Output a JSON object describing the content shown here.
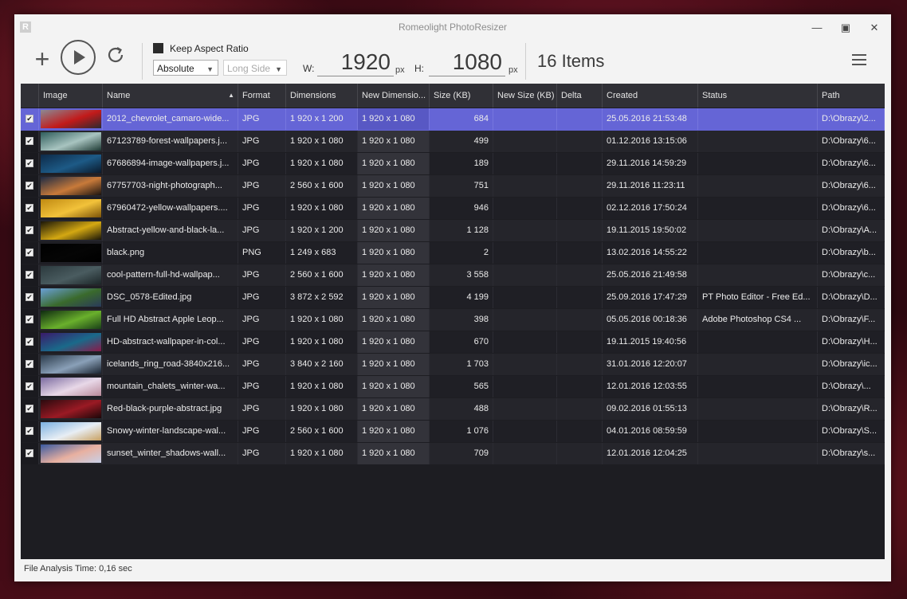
{
  "window": {
    "title": "Romeolight PhotoResizer",
    "logo_letter": "R"
  },
  "toolbar": {
    "keep_aspect_label": "Keep Aspect Ratio",
    "mode_value": "Absolute",
    "side_value": "Long Side",
    "width_label": "W:",
    "width_value": "1920",
    "height_label": "H:",
    "height_value": "1080",
    "unit": "px",
    "items_count": "16 Items"
  },
  "columns": [
    "Image",
    "Name",
    "Format",
    "Dimensions",
    "New Dimensio...",
    "Size (KB)",
    "New Size (KB)",
    "Delta",
    "Created",
    "Status",
    "Path"
  ],
  "rows": [
    {
      "name": "2012_chevrolet_camaro-wide...",
      "format": "JPG",
      "dims": "1 920 x 1 200",
      "newdims": "1 920 x 1 080",
      "size": "684",
      "created": "25.05.2016 21:53:48",
      "status": "",
      "path": "D:\\Obrazy\\2...",
      "thumb": [
        "#8a8a94",
        "#c21a1a",
        "#2a2a30"
      ],
      "selected": true
    },
    {
      "name": "67123789-forest-wallpapers.j...",
      "format": "JPG",
      "dims": "1 920 x 1 080",
      "newdims": "1 920 x 1 080",
      "size": "499",
      "created": "01.12.2016 13:15:06",
      "status": "",
      "path": "D:\\Obrazy\\6...",
      "thumb": [
        "#2f5d5c",
        "#a8c4c0",
        "#1e3a34"
      ]
    },
    {
      "name": "67686894-image-wallpapers.j...",
      "format": "JPG",
      "dims": "1 920 x 1 080",
      "newdims": "1 920 x 1 080",
      "size": "189",
      "created": "29.11.2016 14:59:29",
      "status": "",
      "path": "D:\\Obrazy\\6...",
      "thumb": [
        "#0d2a48",
        "#1d5a86",
        "#0a1a2c"
      ]
    },
    {
      "name": "67757703-night-photograph...",
      "format": "JPG",
      "dims": "2 560 x 1 600",
      "newdims": "1 920 x 1 080",
      "size": "751",
      "created": "29.11.2016 11:23:11",
      "status": "",
      "path": "D:\\Obrazy\\6...",
      "thumb": [
        "#1b2a44",
        "#c87a3a",
        "#1a1410"
      ]
    },
    {
      "name": "67960472-yellow-wallpapers....",
      "format": "JPG",
      "dims": "1 920 x 1 080",
      "newdims": "1 920 x 1 080",
      "size": "946",
      "created": "02.12.2016 17:50:24",
      "status": "",
      "path": "D:\\Obrazy\\6...",
      "thumb": [
        "#c08a12",
        "#f2c23a",
        "#7a5208"
      ]
    },
    {
      "name": "Abstract-yellow-and-black-la...",
      "format": "JPG",
      "dims": "1 920 x 1 200",
      "newdims": "1 920 x 1 080",
      "size": "1 128",
      "created": "19.11.2015 19:50:02",
      "status": "",
      "path": "D:\\Obrazy\\A...",
      "thumb": [
        "#1a1608",
        "#d4a812",
        "#1a1608"
      ]
    },
    {
      "name": "black.png",
      "format": "PNG",
      "dims": "1 249 x 683",
      "newdims": "1 920 x 1 080",
      "size": "2",
      "created": "13.02.2016 14:55:22",
      "status": "",
      "path": "D:\\Obrazy\\b...",
      "thumb": [
        "#000000",
        "#050505",
        "#000000"
      ]
    },
    {
      "name": "cool-pattern-full-hd-wallpap...",
      "format": "JPG",
      "dims": "2 560 x 1 600",
      "newdims": "1 920 x 1 080",
      "size": "3 558",
      "created": "25.05.2016 21:49:58",
      "status": "",
      "path": "D:\\Obrazy\\c...",
      "thumb": [
        "#2c3a3e",
        "#4a5c60",
        "#1c2628"
      ]
    },
    {
      "name": "DSC_0578-Edited.jpg",
      "format": "JPG",
      "dims": "3 872 x 2 592",
      "newdims": "1 920 x 1 080",
      "size": "4 199",
      "created": "25.09.2016 17:47:29",
      "status": "PT Photo Editor - Free Ed...",
      "path": "D:\\Obrazy\\D...",
      "thumb": [
        "#6aa0d8",
        "#3a6a2c",
        "#2a3a5a"
      ]
    },
    {
      "name": "Full HD Abstract Apple Leop...",
      "format": "JPG",
      "dims": "1 920 x 1 080",
      "newdims": "1 920 x 1 080",
      "size": "398",
      "created": "05.05.2016 00:18:36",
      "status": "Adobe Photoshop CS4 ...",
      "path": "D:\\Obrazy\\F...",
      "thumb": [
        "#0e2a10",
        "#6ab02c",
        "#1a4018"
      ]
    },
    {
      "name": "HD-abstract-wallpaper-in-col...",
      "format": "JPG",
      "dims": "1 920 x 1 080",
      "newdims": "1 920 x 1 080",
      "size": "670",
      "created": "19.11.2015 19:40:56",
      "status": "",
      "path": "D:\\Obrazy\\H...",
      "thumb": [
        "#3a1a6a",
        "#1a6a8a",
        "#8a1a4a"
      ]
    },
    {
      "name": "icelands_ring_road-3840x216...",
      "format": "JPG",
      "dims": "3 840 x 2 160",
      "newdims": "1 920 x 1 080",
      "size": "1 703",
      "created": "31.01.2016 12:20:07",
      "status": "",
      "path": "D:\\Obrazy\\ic...",
      "thumb": [
        "#2a3a4a",
        "#8aa0b8",
        "#1a2430"
      ]
    },
    {
      "name": "mountain_chalets_winter-wa...",
      "format": "JPG",
      "dims": "1 920 x 1 080",
      "newdims": "1 920 x 1 080",
      "size": "565",
      "created": "12.01.2016 12:03:55",
      "status": "",
      "path": "D:\\Obrazy\\...",
      "thumb": [
        "#7a6aa0",
        "#e8d8e8",
        "#b88a9a"
      ]
    },
    {
      "name": "Red-black-purple-abstract.jpg",
      "format": "JPG",
      "dims": "1 920 x 1 080",
      "newdims": "1 920 x 1 080",
      "size": "488",
      "created": "09.02.2016 01:55:13",
      "status": "",
      "path": "D:\\Obrazy\\R...",
      "thumb": [
        "#2a0a0e",
        "#9a1a24",
        "#1a0608"
      ]
    },
    {
      "name": "Snowy-winter-landscape-wal...",
      "format": "JPG",
      "dims": "2 560 x 1 600",
      "newdims": "1 920 x 1 080",
      "size": "1 076",
      "created": "04.01.2016 08:59:59",
      "status": "",
      "path": "D:\\Obrazy\\S...",
      "thumb": [
        "#7ab0e0",
        "#e8eef4",
        "#c8a060"
      ]
    },
    {
      "name": "sunset_winter_shadows-wall...",
      "format": "JPG",
      "dims": "1 920 x 1 080",
      "newdims": "1 920 x 1 080",
      "size": "709",
      "created": "12.01.2016 12:04:25",
      "status": "",
      "path": "D:\\Obrazy\\s...",
      "thumb": [
        "#3a5aa0",
        "#e8b0a0",
        "#c8d0e8"
      ]
    }
  ],
  "statusbar": {
    "text": "File Analysis Time: 0,16 sec"
  },
  "colors": {
    "selected_row": "#6565d6",
    "grid_bg": "#1d1d22",
    "header_bg": "#303036"
  }
}
